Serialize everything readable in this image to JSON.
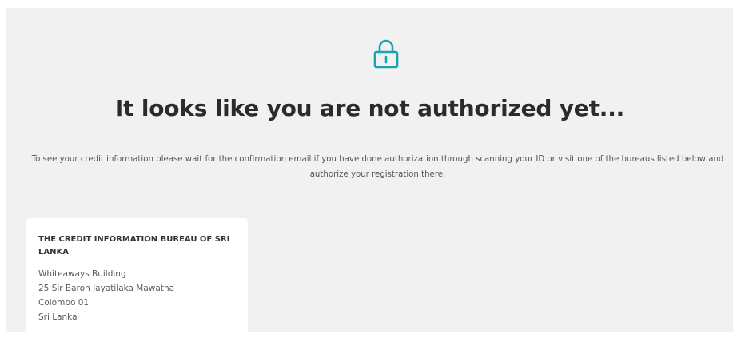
{
  "colors": {
    "accent": "#1aa3b0",
    "panel_background": "#f1f1f1",
    "card_background": "#ffffff",
    "title_text": "#2b2b2b",
    "body_text": "#555555"
  },
  "header": {
    "icon": "lock-icon",
    "title": "It looks like you are not authorized yet...",
    "instructions": "To see your credit information please wait for the confirmation email if you have done authorization through scanning your ID or visit one of the bureaus listed below and authorize your registration there."
  },
  "bureaus": [
    {
      "name": "THE CREDIT INFORMATION BUREAU OF SRI LANKA",
      "address": [
        "Whiteaways Building",
        "25 Sir Baron Jayatilaka Mawatha",
        "Colombo 01",
        "Sri Lanka"
      ]
    }
  ]
}
